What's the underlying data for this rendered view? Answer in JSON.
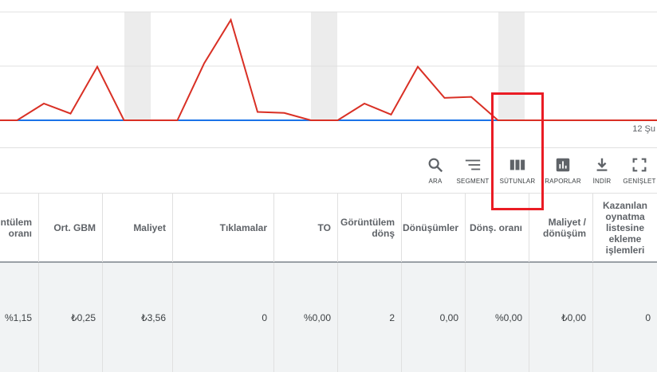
{
  "chart": {
    "date_label": "12 Şu",
    "series": [
      {
        "color": "#d93025",
        "points": [
          0,
          0,
          0.5,
          0.2,
          1.6,
          0,
          0,
          0,
          1.7,
          3,
          0.25,
          0.22,
          0,
          0,
          0.5,
          0.17,
          1.6,
          0.67,
          0.7,
          0,
          0,
          0,
          0,
          0,
          0
        ]
      },
      {
        "color": "#1a73e8",
        "points": [
          0,
          0,
          0,
          0,
          0,
          0,
          0,
          0,
          0,
          0,
          0,
          0,
          0,
          0,
          0,
          0,
          0,
          0,
          0,
          0,
          0,
          0,
          0,
          0,
          0
        ]
      }
    ]
  },
  "toolbar": {
    "search_label": "ARA",
    "segment_label": "SEGMENT",
    "columns_label": "SÜTUNLAR",
    "reports_label": "RAPORLAR",
    "download_label": "İNDİR",
    "expand_label": "GENİŞLET"
  },
  "table": {
    "headers": [
      "üntülem oranı",
      "Ort. GBM",
      "Maliyet",
      "Tıklamalar",
      "TO",
      "Görüntülem dönş",
      "Dönüşümler",
      "Dönş. oranı",
      "Maliyet / dönüşüm",
      "Kazanılan oynatma listesine ekleme işlemleri"
    ],
    "row": [
      "%1,15",
      "₺0,25",
      "₺3,56",
      "0",
      "%0,00",
      "2",
      "0,00",
      "%0,00",
      "₺0,00",
      "0"
    ]
  },
  "colors": {
    "highlight": "#ea1c24",
    "accent_blue": "#1a73e8",
    "accent_red": "#d93025"
  }
}
